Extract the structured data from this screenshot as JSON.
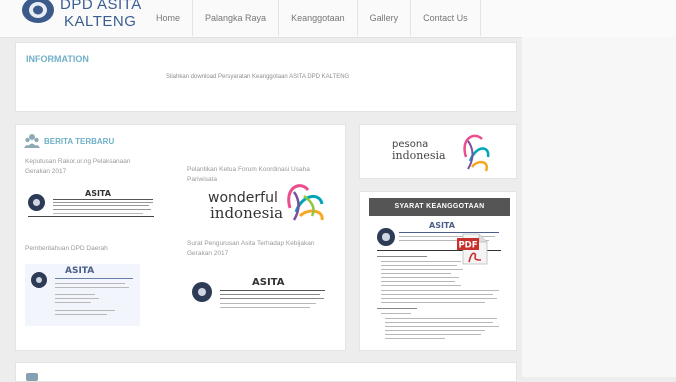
{
  "brand": {
    "line1": "DPD ASITA",
    "line2": "KALTENG",
    "color": "#3a5f8f"
  },
  "nav": {
    "items": [
      {
        "label": "Home"
      },
      {
        "label": "Palangka Raya"
      },
      {
        "label": "Keanggotaan"
      },
      {
        "label": "Gallery"
      },
      {
        "label": "Contact Us"
      }
    ]
  },
  "information": {
    "title": "INFORMATION",
    "marquee": "Silahkan download Persyaratan Keanggotaan ASITA DPD KALTENG"
  },
  "news": {
    "title": "BERITA TERBARU",
    "icon": "users-icon",
    "items": [
      {
        "title": "Keputusan Rakor.ur.ng Pelaksanaan Gerakan 2017"
      },
      {
        "title": "Pelantikan Ketua Forum Koordinasi Usaha Pariwisata"
      },
      {
        "title": "Pemberitahuan DPD Daerah"
      },
      {
        "title": "Surat Pengurusan Asita Terhadap Kebijakan Gerakan 2017"
      }
    ],
    "docs": {
      "heading": "ASITA"
    }
  },
  "promo": {
    "wonderful_line1": "wonderful",
    "wonderful_line2": "indonesia",
    "pesona_line1": "pesona",
    "pesona_line2": "indonesia"
  },
  "syarat": {
    "title": "SYARAT KEANGGOTAAN",
    "doc_heading": "ASITA",
    "pdf_label": "PDF"
  },
  "colors": {
    "accent": "#6fb0c8",
    "header_dark": "#555555",
    "pdf_red": "#c8312b"
  }
}
